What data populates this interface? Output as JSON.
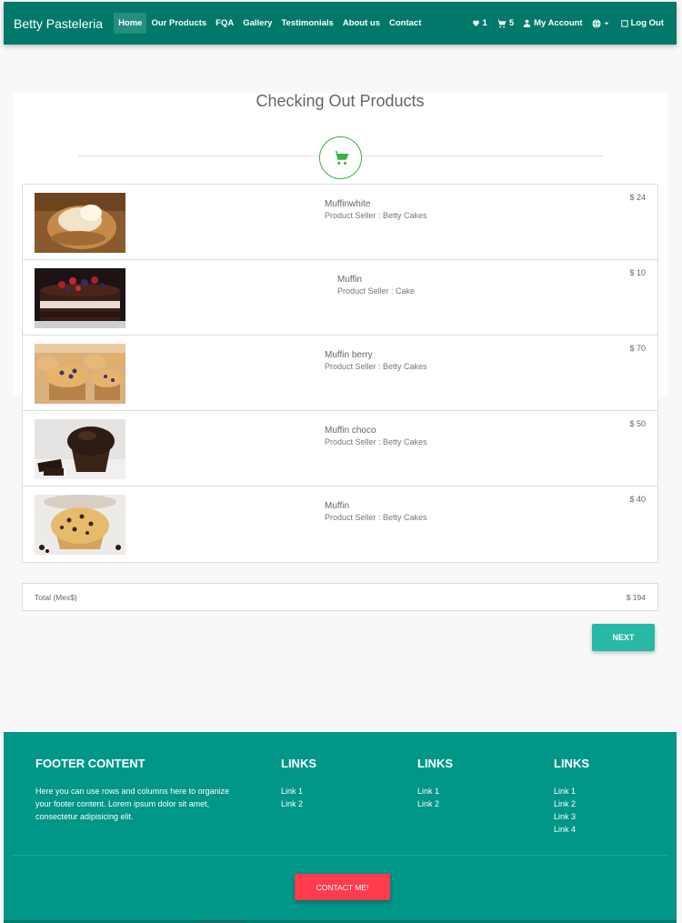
{
  "navbar": {
    "brand": "Betty Pasteleria",
    "links": [
      {
        "label": "Home",
        "active": true
      },
      {
        "label": "Our Products"
      },
      {
        "label": "FQA"
      },
      {
        "label": "Gallery"
      },
      {
        "label": "Testimonials"
      },
      {
        "label": "About us"
      },
      {
        "label": "Contact"
      }
    ],
    "wishlist_count": "1",
    "cart_count": "5",
    "account_label": "My Account",
    "logout_label": "Log Out",
    "icons": {
      "wishlist": "heart-icon",
      "cart": "cart-icon",
      "account": "user-icon",
      "language": "globe-icon",
      "logout": "logout-icon"
    },
    "color": "#00796b"
  },
  "checkout": {
    "title": "Checking Out Products",
    "icon": "cart-icon",
    "accent": "#3cb043"
  },
  "products": [
    {
      "name": "Muffinwhite",
      "seller": "Product Seller : Betty Cakes",
      "price": "$ 24",
      "image": "muffin-white-image"
    },
    {
      "name": "Muffin",
      "seller": "Product Seller : Cake",
      "price": "$ 10",
      "image": "berry-cake-image"
    },
    {
      "name": "Muffin berry",
      "seller": "Product Seller : Betty Cakes",
      "price": "$ 70",
      "image": "muffin-berry-image"
    },
    {
      "name": "Muffin choco",
      "seller": "Product Seller : Betty Cakes",
      "price": "$ 50",
      "image": "muffin-choco-image"
    },
    {
      "name": "Muffin",
      "seller": "Product Seller : Betty Cakes",
      "price": "$ 40",
      "image": "muffin-chip-image"
    }
  ],
  "total": {
    "label": "Total (Mex$)",
    "value": "$ 194"
  },
  "next_label": "NEXT",
  "footer": {
    "heading": "FOOTER CONTENT",
    "text": "Here you can use rows and columns here to organize your footer content. Lorem ipsum dolor sit amet, consectetur adipisicing elit.",
    "columns": [
      {
        "heading": "LINKS",
        "links": [
          "Link 1",
          "Link 2"
        ]
      },
      {
        "heading": "LINKS",
        "links": [
          "Link 1",
          "Link 2"
        ]
      },
      {
        "heading": "LINKS",
        "links": [
          "Link 1",
          "Link 2",
          "Link 3",
          "Link 4"
        ]
      }
    ],
    "contact_label": "CONTACT ME!",
    "color": "#009688",
    "contact_color": "#ff3b4e"
  }
}
